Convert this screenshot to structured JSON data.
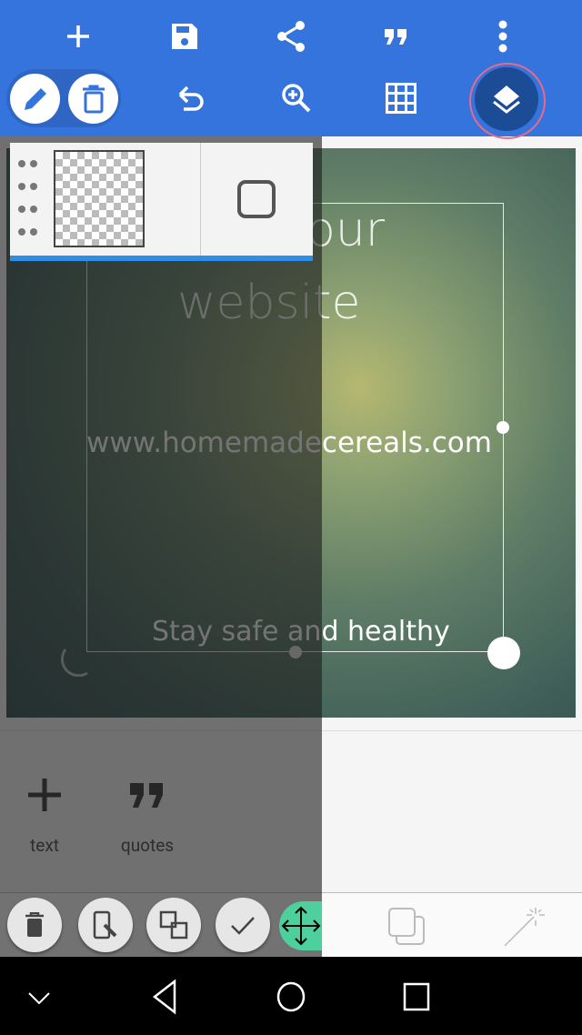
{
  "toolbar": {
    "row1": [
      "add-icon",
      "save-icon",
      "share-icon",
      "quotes-icon",
      "more-vert-icon"
    ],
    "row2": [
      "edit-icon",
      "delete-icon",
      "undo-icon",
      "zoom-in-icon",
      "grid-icon",
      "layers-icon"
    ]
  },
  "canvas": {
    "line1": "our",
    "line2": "website",
    "url": "www.homemadecereals.com",
    "tagline": "Stay safe and healthy"
  },
  "add_panel": {
    "items": [
      {
        "label": "text"
      },
      {
        "label": "quotes"
      }
    ]
  },
  "colors": {
    "primary": "#3474dc",
    "accent_dark": "#1d4c96",
    "move_green": "#4dd09c"
  }
}
